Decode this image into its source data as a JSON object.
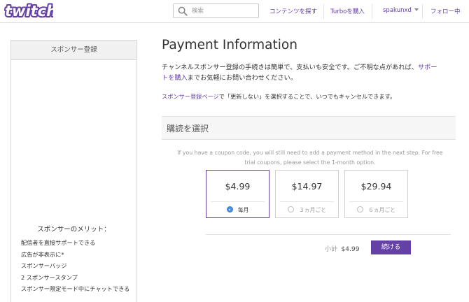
{
  "brand": {
    "logo_text": "twitch",
    "color": "#6441a5"
  },
  "header": {
    "search": {
      "placeholder": "検索",
      "value": ""
    },
    "nav": {
      "browse": "コンテンツを探す",
      "turbo": "Turboを購入",
      "username": "spakunxd",
      "following": "フォロー中"
    }
  },
  "sidebar": {
    "title": "スポンサー登録",
    "perks_title": "スポンサーのメリット：",
    "perks": [
      "配信者を直接サポートできる",
      "広告が非表示に*",
      "スポンサーバッジ",
      "2 スポンサースタンプ",
      "スポンサー限定モード中にチャットできる"
    ]
  },
  "main": {
    "title": "Payment Information",
    "intro_text": "チャンネルスポンサー登録の手続きは簡単で、支払いも安全です。ご不明な点があれば、",
    "intro_link": "サポートを購入",
    "intro_link_a": "サポー",
    "intro_link_b": "トを購入",
    "intro_tail": "までお気軽にお問い合わせください。",
    "note_link": "スポンサー登録ページ",
    "note_text": "で「更新しない」を選択することで、いつでもキャンセルできます。",
    "section_title": "購読を選択",
    "coupon_note": "If you have a coupon code, you will still need to add a payment method in the next step. For free trial coupons, please select the 1-month option.",
    "plans": [
      {
        "price": "$4.99",
        "period": "毎月",
        "selected": true
      },
      {
        "price": "$14.97",
        "period": "３ヵ月ごと",
        "selected": false
      },
      {
        "price": "$29.94",
        "period": "６ヵ月ごと",
        "selected": false
      }
    ],
    "subtotal_label": "小計",
    "subtotal_value": "$4.99",
    "continue_label": "続ける"
  }
}
